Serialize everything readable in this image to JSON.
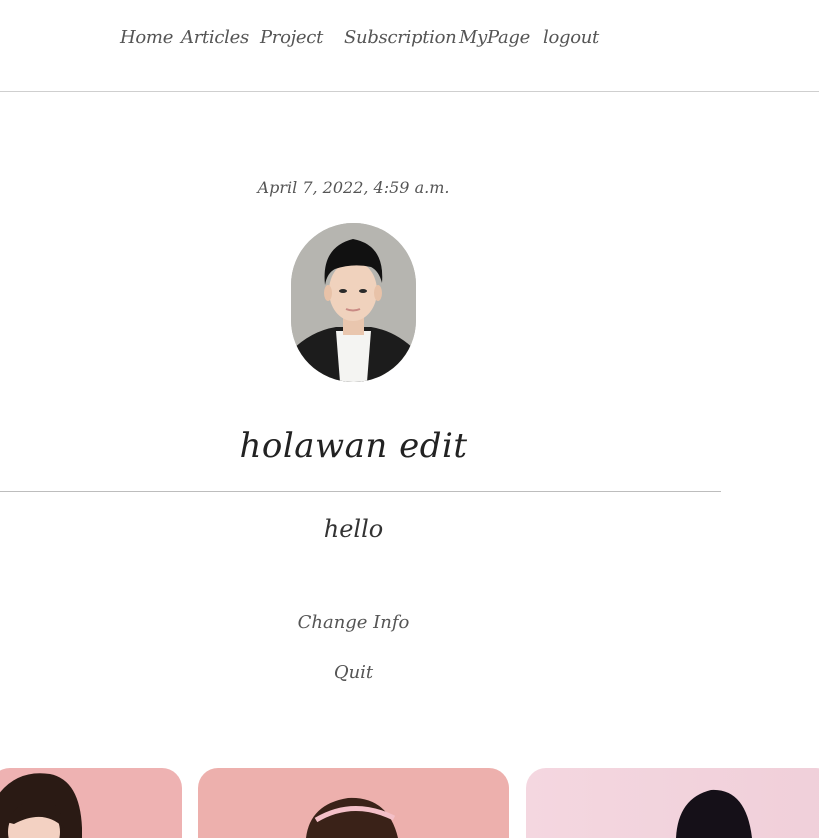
{
  "nav": {
    "items": [
      {
        "label": "Home"
      },
      {
        "label": "Articles"
      },
      {
        "label": "Project"
      },
      {
        "label": "Subscription"
      },
      {
        "label": "MyPage"
      },
      {
        "label": "logout"
      }
    ]
  },
  "profile": {
    "date": "April 7, 2022, 4:59 a.m.",
    "avatar_icon": "profile-photo",
    "username": "holawan edit",
    "bio": "hello",
    "change_info_label": "Change Info",
    "quit_label": "Quit"
  },
  "cards": [
    {
      "image": "card-photo-1",
      "background": "#f0b0b0"
    },
    {
      "image": "card-photo-2",
      "background": "#eeb1ae"
    },
    {
      "image": "card-photo-3",
      "background": "#f2dbe2"
    }
  ]
}
